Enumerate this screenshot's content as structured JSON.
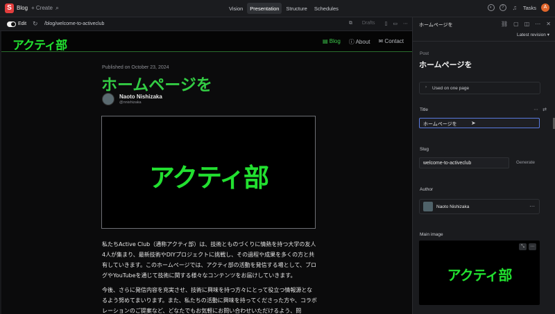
{
  "topbar": {
    "logo_letter": "S",
    "workspace": "Blog",
    "create": "+ Create",
    "search_icon": "search-icon",
    "tabs": [
      {
        "label": "Vision",
        "active": false
      },
      {
        "label": "Presentation",
        "active": true
      },
      {
        "label": "Structure",
        "active": false
      },
      {
        "label": "Schedules",
        "active": false
      }
    ],
    "tasks": "Tasks",
    "avatar_letter": "A"
  },
  "preview_header": {
    "edit_label": "Edit",
    "url": "/blog/welcome-to-activeclub",
    "drafts": "Drafts"
  },
  "site": {
    "brand": "アクティ部",
    "nav": [
      {
        "label": "Blog",
        "active": true
      },
      {
        "label": "About",
        "active": false
      },
      {
        "label": "Contact",
        "active": false
      }
    ],
    "published": "Published on October 23, 2024",
    "title": "ホームページを",
    "author_name": "Naoto Nishizaka",
    "author_handle": "@nnishizaka",
    "hero_text": "アクティ部",
    "paragraphs": [
      "私たちActive Club（通称アクティ部）は、技術とものづくりに情熱を持つ大学の友人4人が集まり、最新技術やDIYプロジェクトに挑戦し、その過程や成果を多くの方と共有していきます。このホームページでは、アクティ部の活動を発信する場として、ブログやYouTubeを通じて技術に関する様々なコンテンツをお届けしていきます。",
      "今後、さらに発信内容を充実させ、技術に興味を持つ方々にとって役立つ情報源となるよう努めてまいります。また、私たちの活動に興味を持ってくださった方や、コラボレーションのご提案など、どなたでもお気軽にお問い合わせいただけるよう、問"
    ]
  },
  "panel": {
    "title": "ホームページを",
    "revision": "Latest revision",
    "kind": "Post",
    "doc_title": "ホームページを",
    "used_on": "Used on one page",
    "fields": {
      "title_label": "Title",
      "title_value": "ホームページを",
      "slug_label": "Slug",
      "slug_value": "welcome-to-activeclub",
      "generate": "Generate",
      "author_label": "Author",
      "author_value": "Naoto Nishizaka",
      "main_image_label": "Main image",
      "main_image_text": "アクティ部"
    }
  },
  "colors": {
    "accent_green": "#22e030",
    "title_green": "#33cc44",
    "logo_red": "#e23d3d",
    "avatar_orange": "#e0662c"
  }
}
